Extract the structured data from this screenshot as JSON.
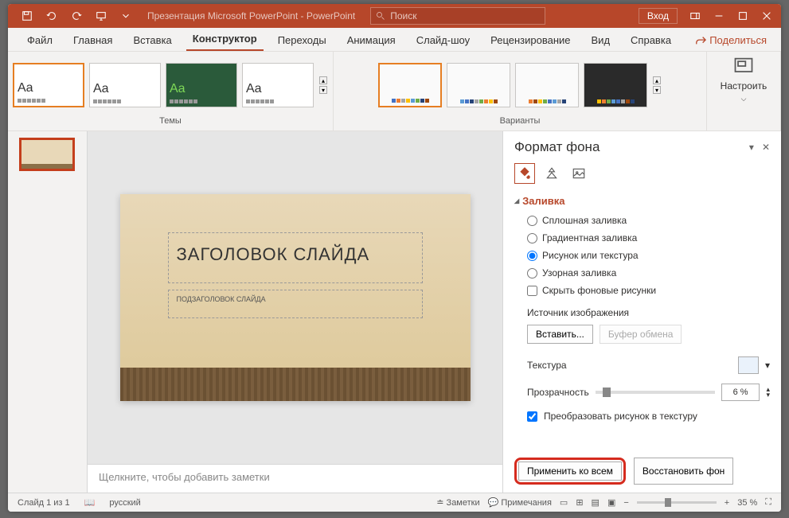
{
  "title": "Презентация Microsoft PowerPoint  -  PowerPoint",
  "search": {
    "placeholder": "Поиск"
  },
  "signin": "Вход",
  "tabs": {
    "file": "Файл",
    "home": "Главная",
    "insert": "Вставка",
    "design": "Конструктор",
    "transitions": "Переходы",
    "animations": "Анимация",
    "slideshow": "Слайд-шоу",
    "review": "Рецензирование",
    "view": "Вид",
    "help": "Справка"
  },
  "share": "Поделиться",
  "ribbon": {
    "themes_label": "Темы",
    "variants_label": "Варианты",
    "customize": "Настроить",
    "theme_aa": "Aa"
  },
  "slide": {
    "num": "1",
    "title": "ЗАГОЛОВОК СЛАЙДА",
    "subtitle": "ПОДЗАГОЛОВОК СЛАЙДА"
  },
  "notes_placeholder": "Щелкните, чтобы добавить заметки",
  "pane": {
    "title": "Формат фона",
    "section": "Заливка",
    "opt_solid": "Сплошная заливка",
    "opt_gradient": "Градиентная заливка",
    "opt_picture": "Рисунок или текстура",
    "opt_pattern": "Узорная заливка",
    "opt_hide": "Скрыть фоновые рисунки",
    "source_label": "Источник изображения",
    "insert": "Вставить...",
    "clipboard": "Буфер обмена",
    "texture": "Текстура",
    "transparency": "Прозрачность",
    "transparency_val": "6 %",
    "tile": "Преобразовать рисунок в текстуру",
    "apply_all": "Применить ко всем",
    "reset": "Восстановить фон"
  },
  "statusbar": {
    "slide": "Слайд 1 из 1",
    "lang": "русский",
    "notes": "Заметки",
    "comments": "Примечания",
    "zoom": "35 %"
  }
}
